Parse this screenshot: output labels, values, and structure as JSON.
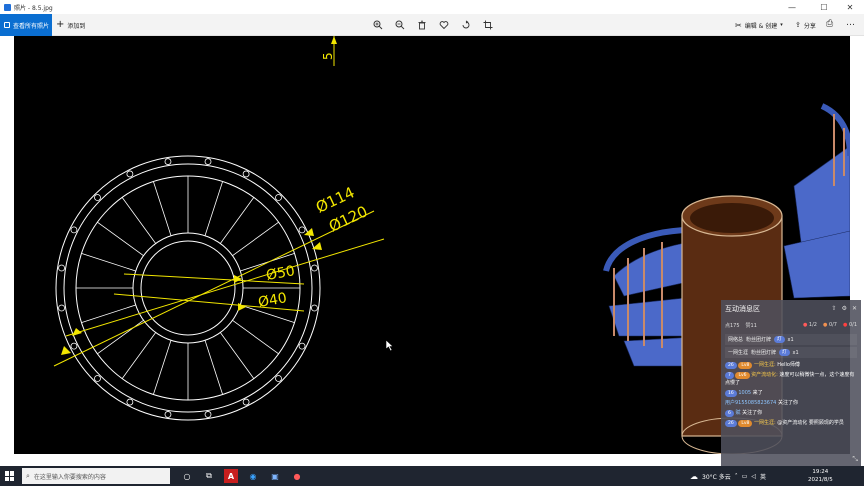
{
  "window": {
    "title": "照片 - 8.5.jpg",
    "controls": {
      "minimize": "—",
      "maximize": "☐",
      "close": "✕"
    }
  },
  "toolbar": {
    "view_all_label": "查看所有照片",
    "add_label": "添加到",
    "edit_create_label": "编辑 & 创建",
    "share_label": "分享",
    "icons": [
      "zoom-in-icon",
      "zoom-out-icon",
      "delete-icon",
      "favorite-icon",
      "rotate-icon",
      "crop-icon",
      "print-icon",
      "more-icon"
    ]
  },
  "drawing": {
    "dimension_labels": [
      "Ø114",
      "Ø120",
      "Ø50",
      "Ø40"
    ],
    "top_label": "5",
    "colors": {
      "background": "#000000",
      "lines": "#ffffff",
      "dimensions": "#f2e600",
      "stair_blue": "#4b69c9",
      "cylinder": "#5a2c12"
    }
  },
  "chat": {
    "title": "互动消息区",
    "stats": {
      "viewers": "点175",
      "likes": "赞11",
      "gift1": "1/2",
      "gift2": "0/7",
      "gift3": "0/1"
    },
    "gift_rows": [
      {
        "user": "网络总",
        "text": "粉丝团灯牌",
        "count": "x1"
      },
      {
        "user": "一网生涯",
        "text": "粉丝团灯牌",
        "count": "x1"
      }
    ],
    "messages": [
      {
        "badge": "26",
        "badge2": "Lv8",
        "user": "一网生涯:",
        "text": "Hello师傅"
      },
      {
        "badge": "7",
        "badge2": "Lv6",
        "user": "资产流动化:",
        "text": "速度可以稍微快一点，这个速度有点慢了"
      },
      {
        "badge": "16",
        "badge2": "",
        "user": "1005",
        "text": "来了"
      },
      {
        "badge": "",
        "badge2": "",
        "user": "用户9155085823674",
        "text": "关注了你"
      },
      {
        "badge": "6",
        "badge2": "",
        "user": "赋",
        "text": "关注了你"
      },
      {
        "badge": "26",
        "badge2": "Lv8",
        "user": "一网生涯:",
        "text": "@资产流动化 要照顾现的学员"
      }
    ]
  },
  "taskbar": {
    "search_placeholder": "在这里输入你要搜索的内容",
    "weather": "30°C 多云",
    "time": "19:24",
    "date": "2021/8/5"
  }
}
